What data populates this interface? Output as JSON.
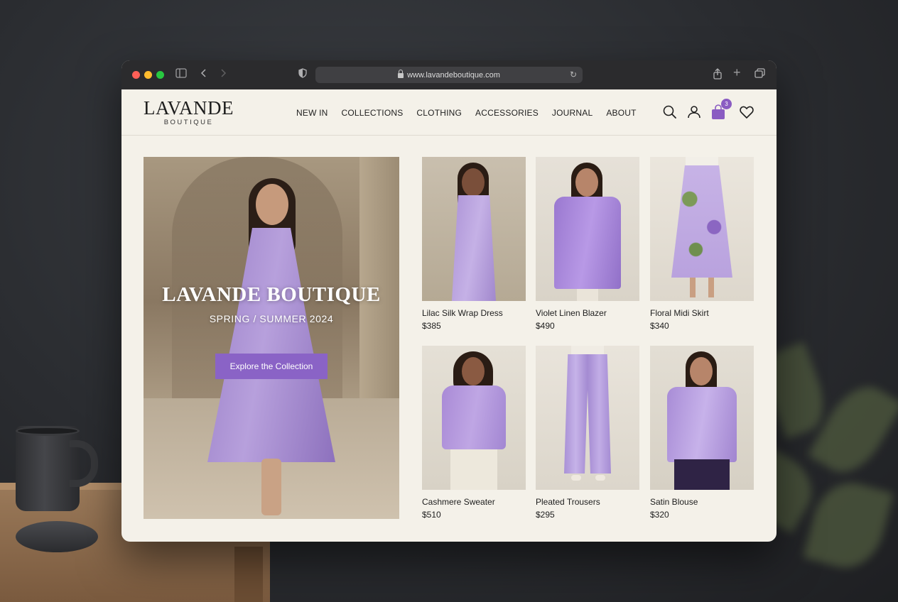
{
  "browser": {
    "url": "www.lavandeboutique.com"
  },
  "site": {
    "logo_main": "LAVANDE",
    "logo_sub": "BOUTIQUE",
    "nav": [
      "NEW IN",
      "COLLECTIONS",
      "CLOTHING",
      "ACCESSORIES",
      "JOURNAL",
      "ABOUT"
    ],
    "cart_count": "3"
  },
  "hero": {
    "title": "LAVANDE BOUTIQUE",
    "subtitle": "SPRING / SUMMER 2024",
    "cta": "Explore the Collection"
  },
  "products": [
    {
      "name": "Lilac Silk Wrap Dress",
      "price": "$385"
    },
    {
      "name": "Violet Linen Blazer",
      "price": "$490"
    },
    {
      "name": "Floral Midi Skirt",
      "price": "$340"
    },
    {
      "name": "Cashmere Sweater",
      "price": "$510"
    },
    {
      "name": "Pleated Trousers",
      "price": "$295"
    },
    {
      "name": "Satin Blouse",
      "price": "$320"
    }
  ],
  "colors": {
    "accent": "#8a63c6",
    "background": "#f4f1e9",
    "lavender": "#b49ada"
  },
  "icons": [
    "search-icon",
    "user-icon",
    "shopping-bag-icon",
    "heart-icon",
    "sidebar-icon",
    "back-icon",
    "forward-icon",
    "shield-icon",
    "share-icon",
    "new-tab-icon",
    "tabs-icon",
    "reload-icon"
  ]
}
